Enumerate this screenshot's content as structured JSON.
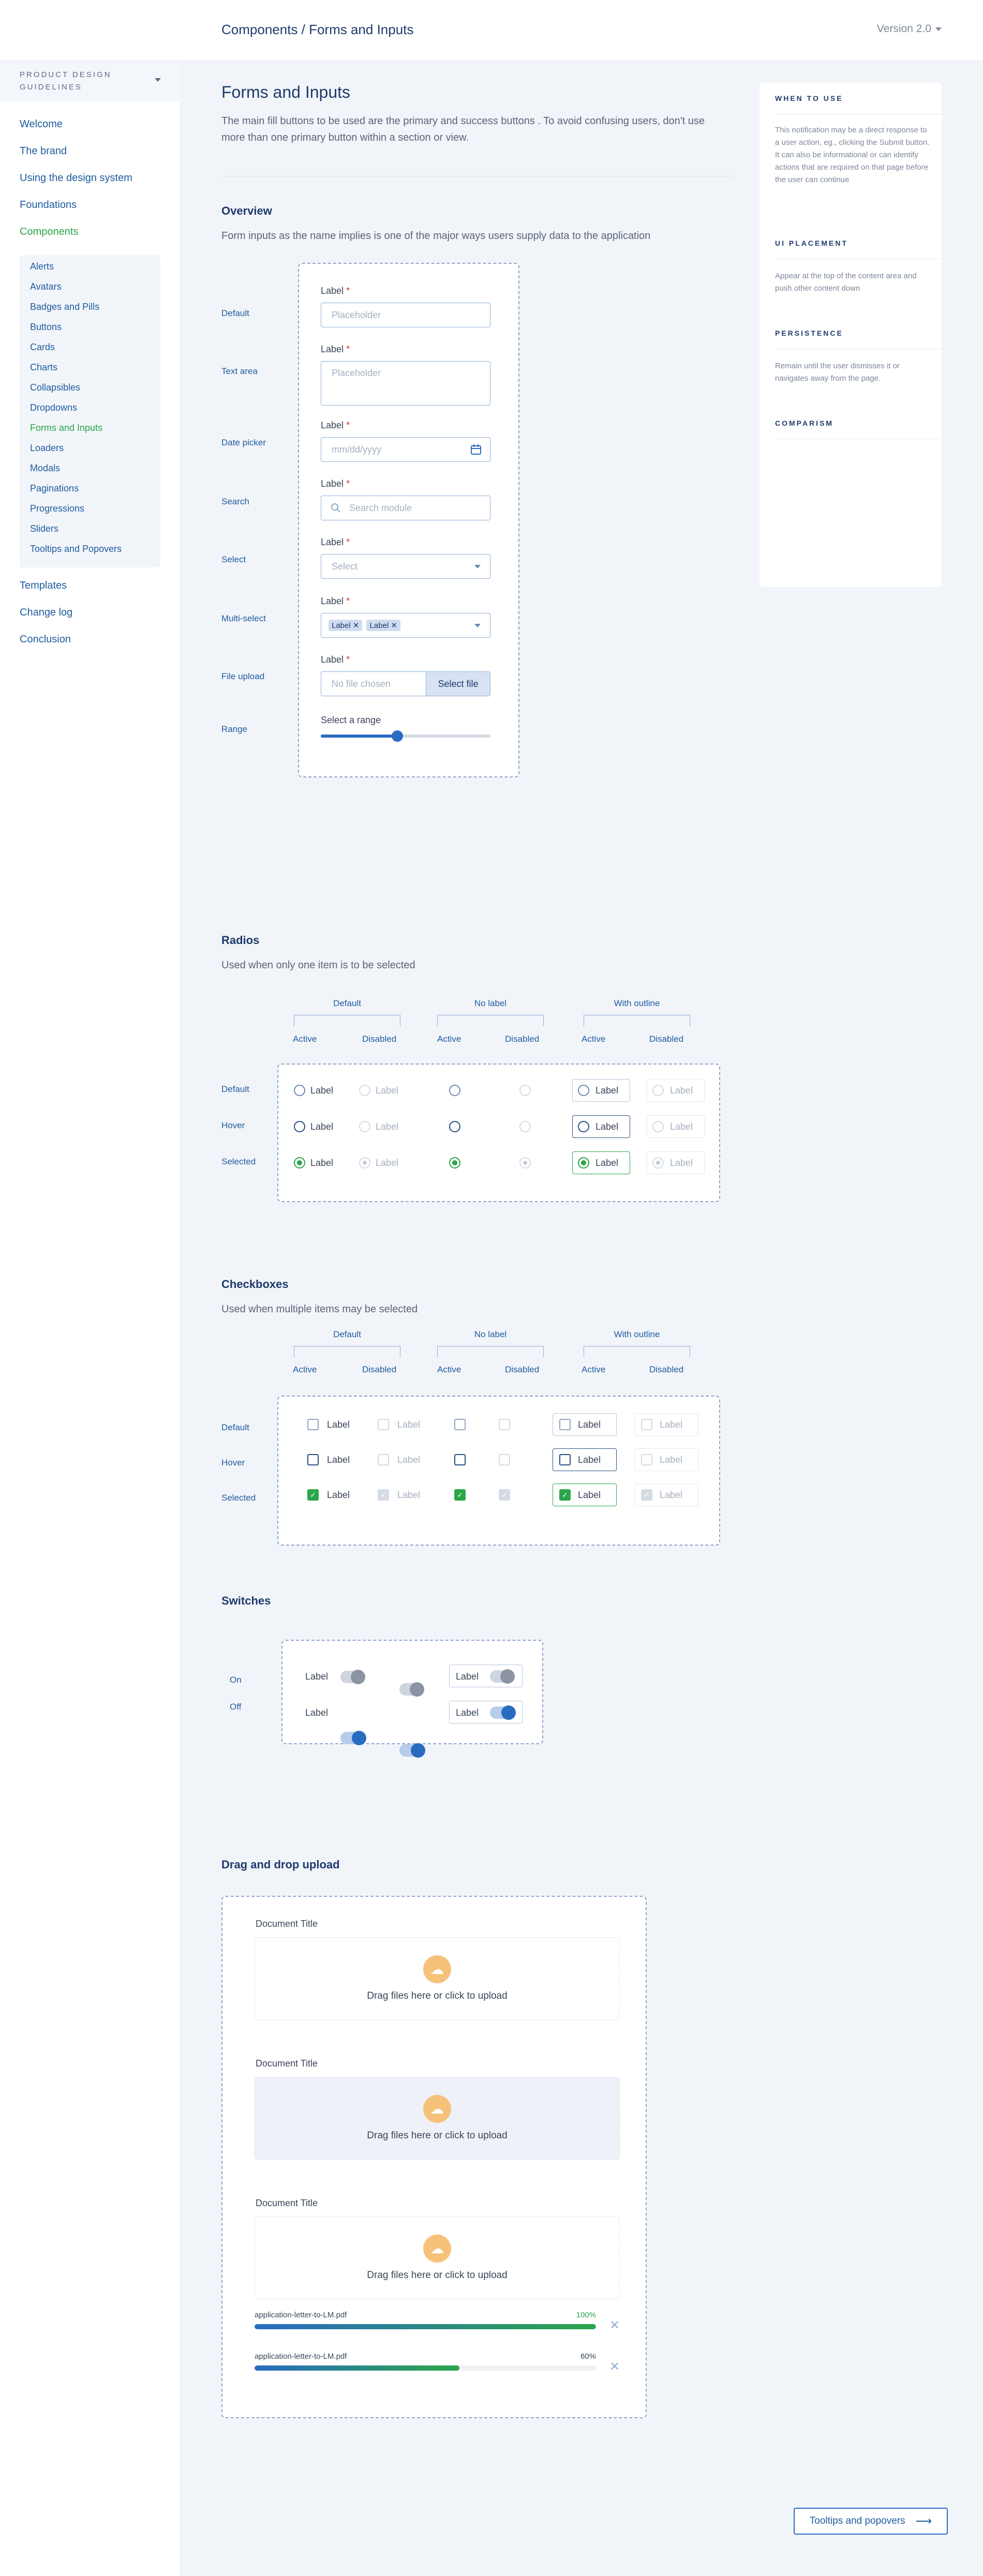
{
  "header": {
    "breadcrumb": "Components / Forms and Inputs",
    "version": "Version 2.0"
  },
  "sidebar": {
    "title_line1": "PRODUCT DESIGN",
    "title_line2": "GUIDELINES",
    "items": [
      "Welcome",
      "The brand",
      "Using the design system",
      "Foundations",
      "Components"
    ],
    "sub_items": [
      "Alerts",
      "Avatars",
      "Badges and Pills",
      "Buttons",
      "Cards",
      "Charts",
      "Collapsibles",
      "Dropdowns",
      "Forms and Inputs",
      "Loaders",
      "Modals",
      "Paginations",
      "Progressions",
      "Sliders",
      "Tooltips and Popovers"
    ],
    "bottom_items": [
      "Templates",
      "Change log",
      "Conclusion"
    ],
    "active_item": "Components",
    "active_sub": "Forms and Inputs"
  },
  "intro": {
    "title": "Forms and Inputs",
    "text": "The main fill buttons to be used are the primary and success buttons . To avoid confusing users, don't use more than one primary button within a section or view."
  },
  "info_panel": {
    "when_title": "WHEN TO USE",
    "when_text": "This notification may be a direct response to a user action, eg., clicking the Submit button. It can also be informational or can identify actions that are required on that page before the user can continue",
    "placement_title": "UI PLACEMENT",
    "placement_text": "Appear at the top of the content area and push other content down",
    "persistence_title": "PERSISTENCE",
    "persistence_text": "Remain until the user dismisses it or navigates away from the page.",
    "comparism_title": "COMPARISM"
  },
  "overview": {
    "title": "Overview",
    "text": "Form inputs as the name implies is one of the major ways users supply data to the application",
    "row_labels": [
      "Default",
      "Text area",
      "Date picker",
      "Search",
      "Select",
      "Multi-select",
      "File upload",
      "Range"
    ],
    "field_label": "Label",
    "required": "*",
    "placeholder": "Placeholder",
    "date_placeholder": "mm/dd/yyyy",
    "search_placeholder": "Search module",
    "select_placeholder": "Select",
    "tags": [
      "Label",
      "Label"
    ],
    "file_placeholder": "No file chosen",
    "file_button": "Select file",
    "range_label": "Select a range",
    "range_value": 0.45
  },
  "radios": {
    "title": "Radios",
    "text": "Used when only one item is to be selected",
    "groups": [
      "Default",
      "No label",
      "With outline"
    ],
    "subcols": [
      "Active",
      "Disabled"
    ],
    "rows": [
      "Default",
      "Hover",
      "Selected"
    ],
    "item_label": "Label"
  },
  "checkboxes": {
    "title": "Checkboxes",
    "text": "Used when multiple items may be selected",
    "groups": [
      "Default",
      "No label",
      "With outline"
    ],
    "subcols": [
      "Active",
      "Disabled"
    ],
    "rows": [
      "Default",
      "Hover",
      "Selected"
    ],
    "item_label": "Label",
    "check": "✓"
  },
  "switches": {
    "title": "Switches",
    "rows": [
      "On",
      "Off"
    ],
    "item_label": "Label"
  },
  "upload": {
    "title": "Drag and drop upload",
    "doc_title": "Document Title",
    "drop_text": "Drag files here or click to upload",
    "files": [
      {
        "name": "application-letter-to-LM.pdf",
        "percent_label": "100%",
        "progress": 1.0
      },
      {
        "name": "application-letter-to-LM.pdf",
        "percent_label": "60%",
        "progress": 0.6
      }
    ]
  },
  "next_button": {
    "label": "Tooltips and popovers",
    "arrow": "⟶"
  },
  "colors": {
    "accent": "#2ba64a",
    "primary": "#1f5c9e",
    "title": "#1f3a6b"
  }
}
